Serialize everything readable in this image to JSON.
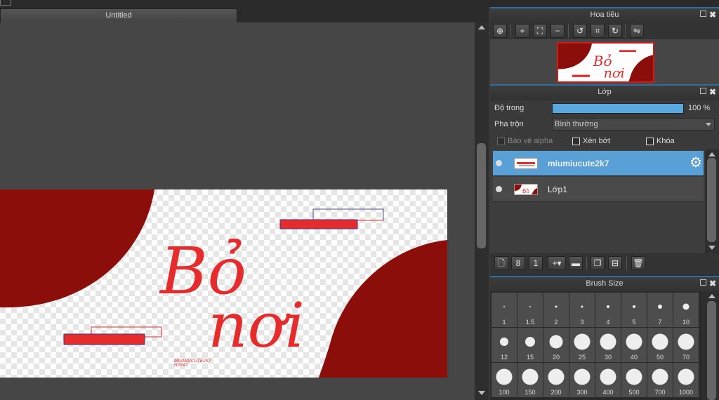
{
  "document": {
    "tab_title": "Untitled"
  },
  "artwork": {
    "title_line1": "Bỏ",
    "title_line2": "nơi",
    "credit_line1": "MIUMIUCUTE2K7",
    "credit_line2": "H2P47",
    "colors": {
      "dark_red": "#8b0e0a",
      "red": "#e52b2b",
      "outline": "#3a3a8a"
    }
  },
  "navigator": {
    "title": "Hoa tiêu",
    "tools": [
      {
        "name": "zoom-fit-icon",
        "glyph": "⊕"
      },
      {
        "name": "zoom-in-icon",
        "glyph": "+"
      },
      {
        "name": "fit-screen-icon",
        "glyph": "⛶"
      },
      {
        "name": "zoom-out-icon",
        "glyph": "−"
      },
      {
        "name": "rotate-left-icon",
        "glyph": "↺"
      },
      {
        "name": "reset-view-icon",
        "glyph": "⌗"
      },
      {
        "name": "rotate-right-icon",
        "glyph": "↻"
      },
      {
        "name": "flip-horizontal-icon",
        "glyph": "⇋"
      }
    ]
  },
  "layers": {
    "title": "Lớp",
    "opacity_label": "Độ trong",
    "opacity_value": "100 %",
    "opacity_fraction": 1.0,
    "blend_label": "Pha trộn",
    "blend_value": "Bình thường",
    "protect_alpha_label": "Bảo vệ alpha",
    "clipping_label": "Xén bớt",
    "lock_label": "Khóa",
    "items": [
      {
        "name": "miumiucute2k7",
        "selected": true
      },
      {
        "name": "Lớp1",
        "selected": false
      }
    ],
    "toolbar": [
      {
        "name": "new-layer-icon",
        "glyph": "🗋"
      },
      {
        "name": "new-8bit-layer-icon",
        "glyph": "8"
      },
      {
        "name": "new-1bit-layer-icon",
        "glyph": "1"
      },
      {
        "name": "add-layer-dropdown-icon",
        "glyph": "+▾"
      },
      {
        "name": "new-folder-icon",
        "glyph": "▬"
      },
      {
        "name": "duplicate-layer-icon",
        "glyph": "❐"
      },
      {
        "name": "merge-down-icon",
        "glyph": "⊟"
      },
      {
        "name": "delete-layer-icon",
        "glyph": "🗑"
      }
    ]
  },
  "brush_size": {
    "title": "Brush Size",
    "sizes": [
      "1",
      "1.5",
      "2",
      "3",
      "4",
      "5",
      "7",
      "10",
      "12",
      "15",
      "20",
      "25",
      "30",
      "40",
      "50",
      "70",
      "100",
      "150",
      "200",
      "300",
      "400",
      "500",
      "700",
      "1000"
    ]
  }
}
